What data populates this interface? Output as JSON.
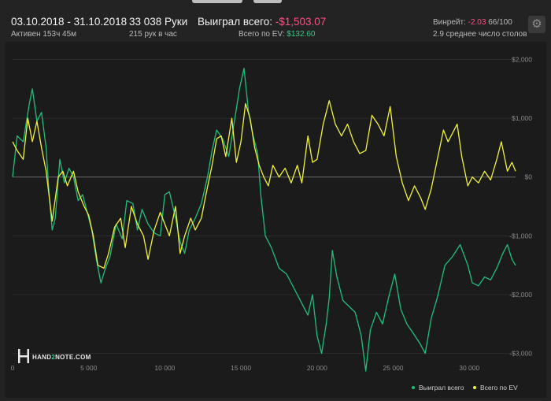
{
  "header": {
    "date_range": "03.10.2018 - 31.10.2018",
    "active_time": "Активен 153ч 45м",
    "hands": "33 038 Руки",
    "hands_per_hour": "215 рук в час",
    "won_label": "Выиграл всего:",
    "won_value": "-$1,503.07",
    "ev_label": "Всего по EV:",
    "ev_value": "$132.60",
    "winrate_label": "Винрейт:",
    "winrate_value": "-2.03",
    "winrate_suffix": "66/100",
    "tables": "2.9 среднее число столов",
    "settings_icon": "gear-icon"
  },
  "logo": {
    "text_left": "HAND",
    "text_mid": "2",
    "text_right": "NOTE.COM"
  },
  "colors": {
    "won": "#1fbf7c",
    "ev": "#f2f23a",
    "neg": "#ff4f83",
    "pos": "#38c886"
  },
  "chart_data": {
    "type": "line",
    "x_ticks": [
      0,
      5000,
      10000,
      15000,
      20000,
      25000,
      30000
    ],
    "x_tick_labels": [
      "0",
      "5 000",
      "10 000",
      "15 000",
      "20 000",
      "25 000",
      "30 000"
    ],
    "y_ticks": [
      2000,
      1000,
      0,
      -1000,
      -2000,
      -3000
    ],
    "y_tick_labels": [
      "$2,000",
      "$1,000",
      "$0",
      "-$1,000",
      "-$2,000",
      "-$3,000"
    ],
    "xlim": [
      0,
      33038
    ],
    "ylim": [
      -3300,
      2100
    ],
    "legend_position": "bottom-right",
    "series": [
      {
        "name": "Выиграл всего",
        "color": "#1fbf7c",
        "points": [
          [
            0,
            0
          ],
          [
            300,
            700
          ],
          [
            700,
            600
          ],
          [
            1100,
            1250
          ],
          [
            1300,
            1500
          ],
          [
            1600,
            950
          ],
          [
            1900,
            1100
          ],
          [
            2200,
            500
          ],
          [
            2400,
            -300
          ],
          [
            2600,
            -900
          ],
          [
            2800,
            -700
          ],
          [
            3100,
            300
          ],
          [
            3400,
            -100
          ],
          [
            3700,
            150
          ],
          [
            4000,
            0
          ],
          [
            4300,
            -400
          ],
          [
            4600,
            -300
          ],
          [
            4900,
            -600
          ],
          [
            5200,
            -900
          ],
          [
            5500,
            -1400
          ],
          [
            5800,
            -1800
          ],
          [
            6100,
            -1550
          ],
          [
            6400,
            -1350
          ],
          [
            6800,
            -800
          ],
          [
            7200,
            -1050
          ],
          [
            7500,
            -400
          ],
          [
            7900,
            -450
          ],
          [
            8200,
            -900
          ],
          [
            8500,
            -550
          ],
          [
            8900,
            -800
          ],
          [
            9300,
            -950
          ],
          [
            9700,
            -1000
          ],
          [
            10000,
            -300
          ],
          [
            10300,
            -250
          ],
          [
            10700,
            -700
          ],
          [
            11000,
            -1100
          ],
          [
            11300,
            -1300
          ],
          [
            11600,
            -900
          ],
          [
            12000,
            -700
          ],
          [
            12400,
            -450
          ],
          [
            12800,
            0
          ],
          [
            13100,
            450
          ],
          [
            13400,
            800
          ],
          [
            13800,
            650
          ],
          [
            14200,
            350
          ],
          [
            14600,
            1000
          ],
          [
            14900,
            1500
          ],
          [
            15200,
            1850
          ],
          [
            15500,
            1100
          ],
          [
            15800,
            700
          ],
          [
            16100,
            400
          ],
          [
            16300,
            -300
          ],
          [
            16600,
            -1000
          ],
          [
            17000,
            -1200
          ],
          [
            17500,
            -1550
          ],
          [
            18000,
            -1650
          ],
          [
            18500,
            -1900
          ],
          [
            19000,
            -2150
          ],
          [
            19400,
            -2350
          ],
          [
            19700,
            -2000
          ],
          [
            20000,
            -2700
          ],
          [
            20300,
            -3000
          ],
          [
            20600,
            -2500
          ],
          [
            20800,
            -2050
          ],
          [
            21000,
            -1250
          ],
          [
            21300,
            -1700
          ],
          [
            21700,
            -2100
          ],
          [
            22100,
            -2200
          ],
          [
            22500,
            -2300
          ],
          [
            22900,
            -2700
          ],
          [
            23200,
            -3300
          ],
          [
            23500,
            -2600
          ],
          [
            23900,
            -2300
          ],
          [
            24300,
            -2500
          ],
          [
            24700,
            -2050
          ],
          [
            25100,
            -1650
          ],
          [
            25500,
            -2250
          ],
          [
            25900,
            -2500
          ],
          [
            26300,
            -2650
          ],
          [
            26800,
            -2850
          ],
          [
            27100,
            -3000
          ],
          [
            27500,
            -2400
          ],
          [
            27900,
            -2050
          ],
          [
            28400,
            -1500
          ],
          [
            28900,
            -1350
          ],
          [
            29400,
            -1150
          ],
          [
            29900,
            -1500
          ],
          [
            30200,
            -1800
          ],
          [
            30600,
            -1850
          ],
          [
            31000,
            -1700
          ],
          [
            31400,
            -1750
          ],
          [
            31800,
            -1550
          ],
          [
            32200,
            -1300
          ],
          [
            32500,
            -1150
          ],
          [
            32800,
            -1400
          ],
          [
            33038,
            -1503
          ]
        ]
      },
      {
        "name": "Всего по EV",
        "color": "#f2f23a",
        "points": [
          [
            0,
            600
          ],
          [
            300,
            450
          ],
          [
            700,
            300
          ],
          [
            1000,
            1000
          ],
          [
            1300,
            600
          ],
          [
            1600,
            950
          ],
          [
            1900,
            500
          ],
          [
            2200,
            100
          ],
          [
            2600,
            -750
          ],
          [
            3000,
            0
          ],
          [
            3300,
            100
          ],
          [
            3600,
            -150
          ],
          [
            4000,
            100
          ],
          [
            4300,
            -250
          ],
          [
            4700,
            -500
          ],
          [
            5000,
            -650
          ],
          [
            5300,
            -1000
          ],
          [
            5600,
            -1500
          ],
          [
            6000,
            -1550
          ],
          [
            6300,
            -1300
          ],
          [
            6700,
            -850
          ],
          [
            7100,
            -700
          ],
          [
            7400,
            -1200
          ],
          [
            7800,
            -500
          ],
          [
            8200,
            -800
          ],
          [
            8600,
            -1000
          ],
          [
            8900,
            -1400
          ],
          [
            9300,
            -900
          ],
          [
            9700,
            -600
          ],
          [
            10000,
            -800
          ],
          [
            10300,
            -1000
          ],
          [
            10700,
            -500
          ],
          [
            11000,
            -1300
          ],
          [
            11300,
            -1000
          ],
          [
            11700,
            -700
          ],
          [
            12000,
            -900
          ],
          [
            12400,
            -700
          ],
          [
            12700,
            -300
          ],
          [
            13100,
            200
          ],
          [
            13400,
            650
          ],
          [
            13700,
            700
          ],
          [
            14000,
            350
          ],
          [
            14400,
            1000
          ],
          [
            14700,
            250
          ],
          [
            15000,
            600
          ],
          [
            15300,
            1250
          ],
          [
            15600,
            1000
          ],
          [
            15900,
            500
          ],
          [
            16200,
            200
          ],
          [
            16500,
            0
          ],
          [
            16800,
            -150
          ],
          [
            17100,
            200
          ],
          [
            17500,
            0
          ],
          [
            17900,
            150
          ],
          [
            18300,
            -100
          ],
          [
            18700,
            200
          ],
          [
            19000,
            -100
          ],
          [
            19400,
            700
          ],
          [
            19700,
            250
          ],
          [
            20000,
            300
          ],
          [
            20400,
            900
          ],
          [
            20800,
            1300
          ],
          [
            21200,
            900
          ],
          [
            21600,
            700
          ],
          [
            22000,
            900
          ],
          [
            22400,
            600
          ],
          [
            22800,
            400
          ],
          [
            23200,
            450
          ],
          [
            23600,
            1050
          ],
          [
            24000,
            900
          ],
          [
            24400,
            700
          ],
          [
            24800,
            1200
          ],
          [
            25200,
            350
          ],
          [
            25600,
            -100
          ],
          [
            26000,
            -400
          ],
          [
            26400,
            -150
          ],
          [
            26800,
            -350
          ],
          [
            27100,
            -550
          ],
          [
            27500,
            -200
          ],
          [
            27900,
            300
          ],
          [
            28300,
            800
          ],
          [
            28600,
            600
          ],
          [
            28900,
            750
          ],
          [
            29200,
            900
          ],
          [
            29500,
            350
          ],
          [
            29900,
            -150
          ],
          [
            30200,
            0
          ],
          [
            30600,
            -100
          ],
          [
            31000,
            100
          ],
          [
            31400,
            -50
          ],
          [
            31800,
            300
          ],
          [
            32100,
            600
          ],
          [
            32500,
            100
          ],
          [
            32800,
            250
          ],
          [
            33038,
            100
          ]
        ]
      }
    ]
  }
}
